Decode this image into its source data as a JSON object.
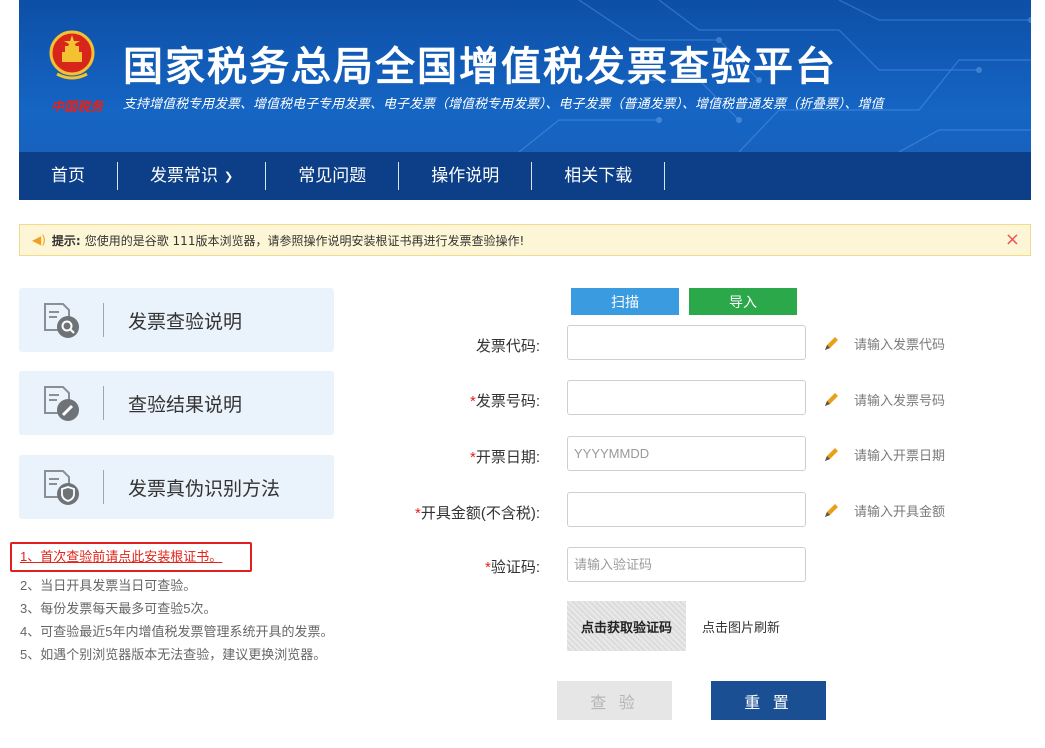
{
  "header": {
    "title": "国家税务总局全国增值税发票查验平台",
    "subtitle": "支持增值税专用发票、增值税电子专用发票、电子发票（增值税专用发票）、电子发票（普通发票）、增值税普通发票（折叠票）、增值",
    "brand_text": "中国税务",
    "colors": {
      "header_bg": "#1565c4",
      "nav_bg": "#0c3f88",
      "brand_red": "#e2231a"
    }
  },
  "nav": {
    "home": "首页",
    "knowledge": "发票常识",
    "faq": "常见问题",
    "guide": "操作说明",
    "downloads": "相关下载"
  },
  "notice": {
    "label": "提示:",
    "text": "您使用的是谷歌 111版本浏览器，请参照操作说明安装根证书再进行发票查验操作!",
    "close": "×"
  },
  "cards": {
    "verify_desc": "发票查验说明",
    "result_desc": "查验结果说明",
    "fake_desc": "发票真伪识别方法"
  },
  "notes": [
    "1、首次查验前请点此安装根证书。",
    "2、当日开具发票当日可查验。",
    "3、每份发票每天最多可查验5次。",
    "4、可查验最近5年内增值税发票管理系统开具的发票。",
    "5、如遇个别浏览器版本无法查验，建议更换浏览器。"
  ],
  "form": {
    "scan": "扫描",
    "import": "导入",
    "code_label": "发票代码:",
    "code_hint": "请输入发票代码",
    "number_label": "发票号码:",
    "number_hint": "请输入发票号码",
    "date_label": "开票日期:",
    "date_placeholder": "YYYYMMDD",
    "date_hint": "请输入开票日期",
    "amount_label": "开具金额(不含税):",
    "amount_hint": "请输入开具金额",
    "captcha_label": "验证码:",
    "captcha_placeholder": "请输入验证码",
    "captcha_image_text": "点击获取验证码",
    "captcha_refresh": "点击图片刷新",
    "required_mark": "*",
    "verify": "查 验",
    "reset": "重 置"
  }
}
